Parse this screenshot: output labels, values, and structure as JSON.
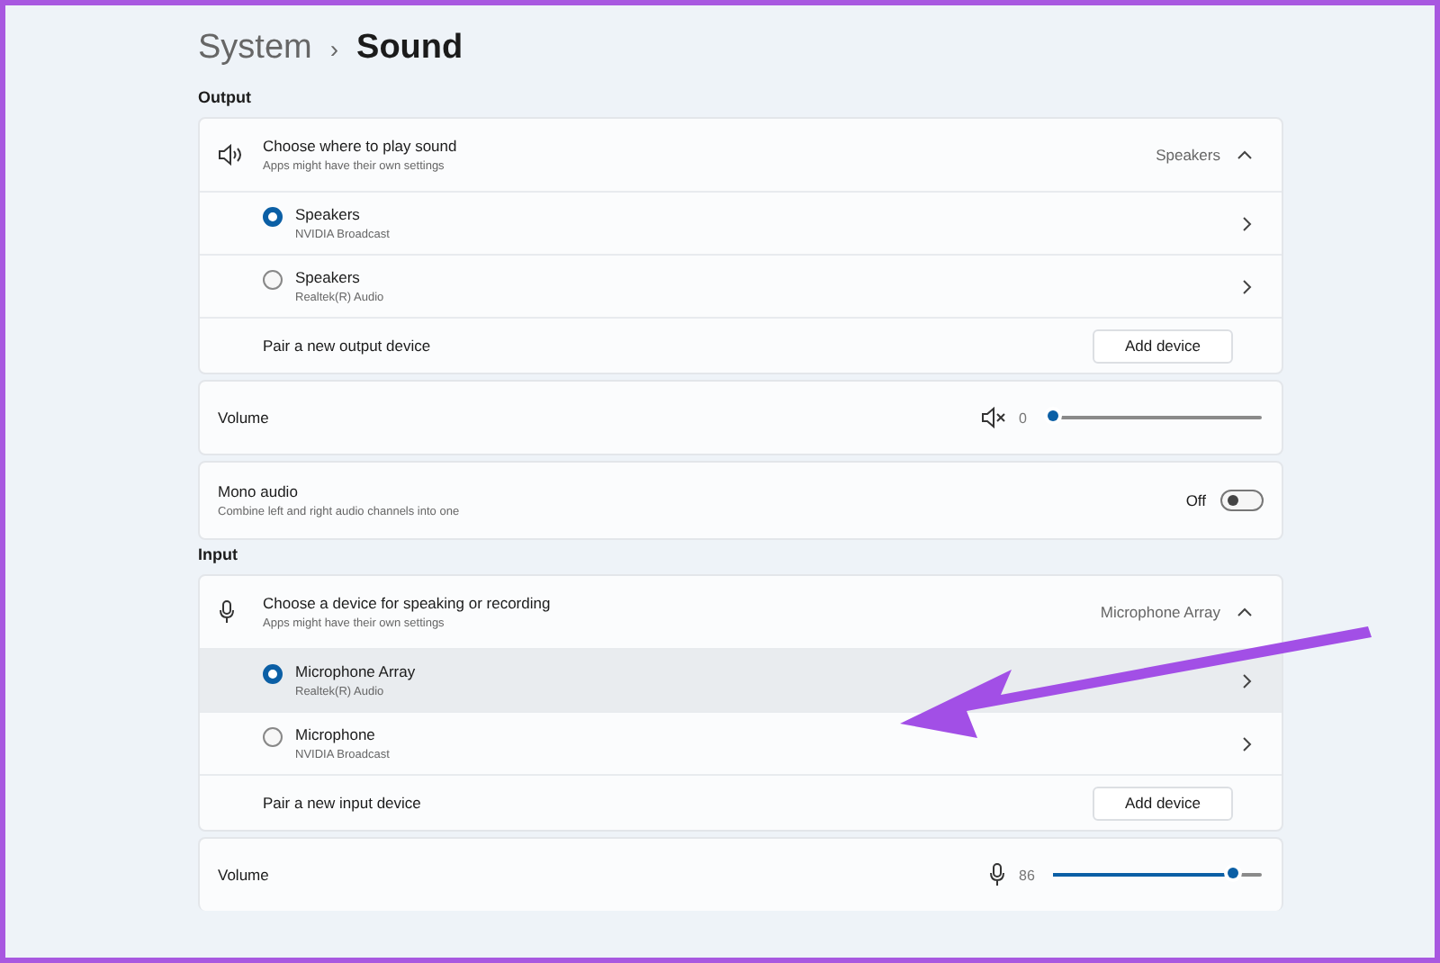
{
  "breadcrumb": {
    "parent": "System",
    "separator": "›",
    "current": "Sound"
  },
  "sections": [
    {
      "heading": "Output",
      "chooser": {
        "title": "Choose where to play sound",
        "subtitle": "Apps might have their own settings",
        "value": "Speakers",
        "expanded": true
      },
      "devices": [
        {
          "name": "Speakers",
          "detail": "NVIDIA Broadcast",
          "selected": true,
          "hovered": false
        },
        {
          "name": "Speakers",
          "detail": "Realtek(R) Audio",
          "selected": false,
          "hovered": false
        }
      ],
      "pair": {
        "label": "Pair a new output device",
        "button": "Add device"
      },
      "settings": [
        {
          "kind": "volume",
          "label": "Volume",
          "reading": "0",
          "level": 0
        },
        {
          "kind": "toggle",
          "label": "Mono audio",
          "description": "Combine left and right audio channels into one",
          "state_label": "Off",
          "on": false
        }
      ]
    },
    {
      "heading": "Input",
      "chooser": {
        "title": "Choose a device for speaking or recording",
        "subtitle": "Apps might have their own settings",
        "value": "Microphone Array",
        "expanded": true
      },
      "devices": [
        {
          "name": "Microphone Array",
          "detail": "Realtek(R) Audio",
          "selected": true,
          "hovered": true
        },
        {
          "name": "Microphone",
          "detail": "NVIDIA Broadcast",
          "selected": false,
          "hovered": false
        }
      ],
      "pair": {
        "label": "Pair a new input device",
        "button": "Add device"
      },
      "settings": [
        {
          "kind": "volume",
          "label": "Volume",
          "reading": "86",
          "level": 0.86
        }
      ]
    }
  ]
}
